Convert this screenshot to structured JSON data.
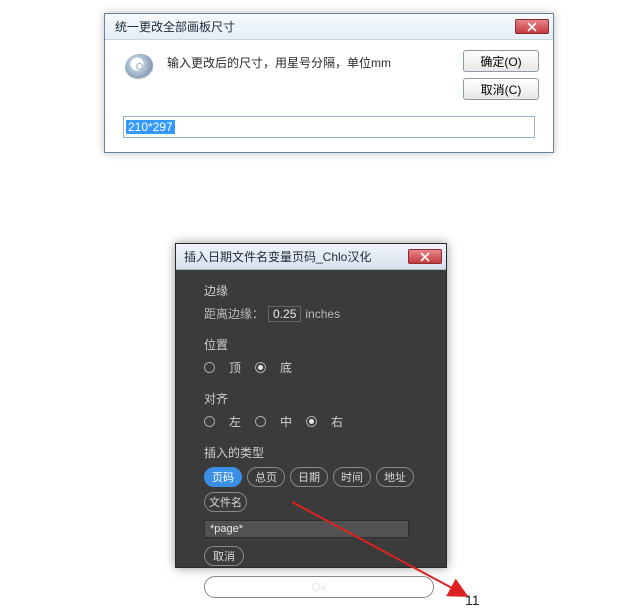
{
  "dlg1": {
    "title": "统一更改全部画板尺寸",
    "message": "输入更改后的尺寸，用星号分隔，单位mm",
    "ok_label": "确定(O)",
    "cancel_label": "取消(C)",
    "input_value": "210*297"
  },
  "dlg2": {
    "title": "插入日期文件名变量页码_Chlo汉化",
    "margin_heading": "边缘",
    "margin_label": "距离边缘：",
    "margin_value": "0.25",
    "margin_unit": "inches",
    "position_heading": "位置",
    "pos_top": "顶",
    "pos_bottom": "底",
    "align_heading": "对齐",
    "align_left": "左",
    "align_center": "中",
    "align_right": "右",
    "insert_heading": "插入的类型",
    "pills": {
      "page": "页码",
      "total": "总页",
      "date": "日期",
      "time": "时间",
      "addr": "地址",
      "file": "文件名"
    },
    "input_value": "*page*",
    "cancel_label": "取消",
    "ok_label": "Ok"
  },
  "page_number": "11"
}
